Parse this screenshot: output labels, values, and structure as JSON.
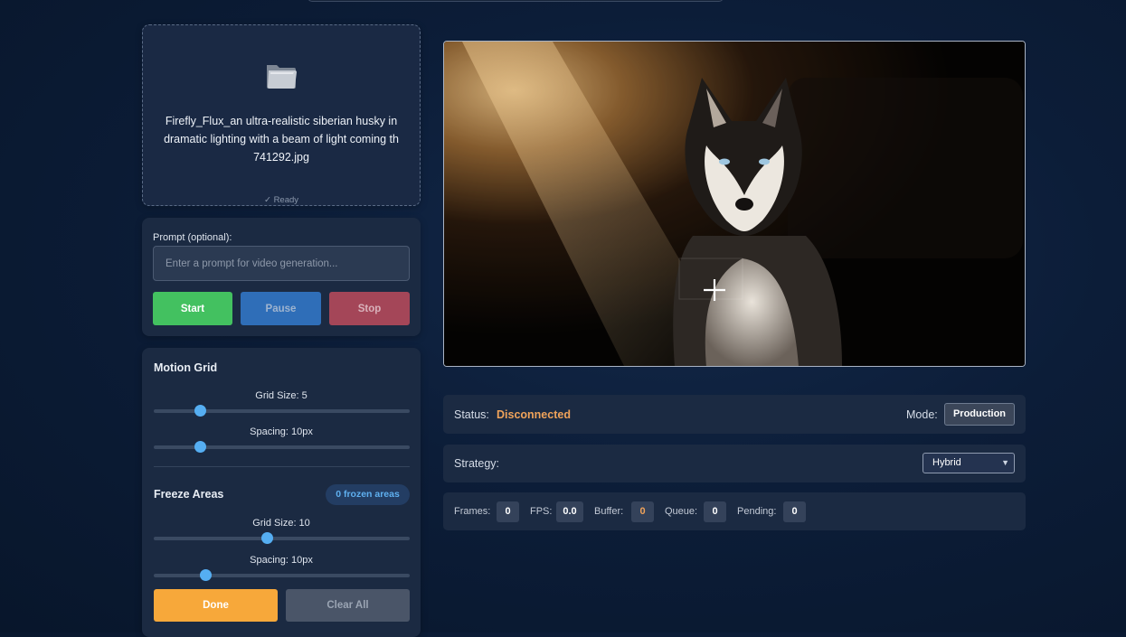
{
  "upload": {
    "icon": "folder-icon",
    "filename": "Firefly_Flux_an ultra-realistic siberian husky in dramatic lighting with a beam of light coming th 741292.jpg",
    "status": "✓ Ready"
  },
  "prompt": {
    "label": "Prompt (optional):",
    "placeholder": "Enter a prompt for video generation...",
    "value": ""
  },
  "controls": {
    "start_label": "Start",
    "pause_label": "Pause",
    "stop_label": "Stop",
    "colors": {
      "start": "#43c160",
      "pause": "#2f6eb8",
      "stop": "#a44658"
    }
  },
  "motion_grid": {
    "title": "Motion Grid",
    "grid_size_label": "Grid Size: 5",
    "grid_size_fraction": 0.18,
    "spacing_label": "Spacing: 10px",
    "spacing_fraction": 0.18
  },
  "freeze_areas": {
    "title": "Freeze Areas",
    "badge": "0 frozen areas",
    "grid_size_label": "Grid Size: 10",
    "grid_size_fraction": 0.44,
    "spacing_label": "Spacing: 10px",
    "spacing_fraction": 0.2,
    "done_label": "Done",
    "clear_label": "Clear All",
    "colors": {
      "done": "#f7a83a",
      "clear": "#4a5568"
    }
  },
  "preview": {
    "image_subject": "siberian husky in dramatic lighting",
    "cursor_icon": "crosshair-icon"
  },
  "status": {
    "label": "Status:",
    "value": "Disconnected",
    "value_color": "#f0a35a",
    "mode_label": "Mode:",
    "mode_value": "Production"
  },
  "strategy": {
    "label": "Strategy:",
    "selected": "Hybrid"
  },
  "stats": {
    "frames_label": "Frames:",
    "frames": "0",
    "fps_label": "FPS:",
    "fps": "0.0",
    "buffer_label": "Buffer:",
    "buffer": "0",
    "buffer_color": "#f0a35a",
    "queue_label": "Queue:",
    "queue": "0",
    "pending_label": "Pending:",
    "pending": "0"
  }
}
